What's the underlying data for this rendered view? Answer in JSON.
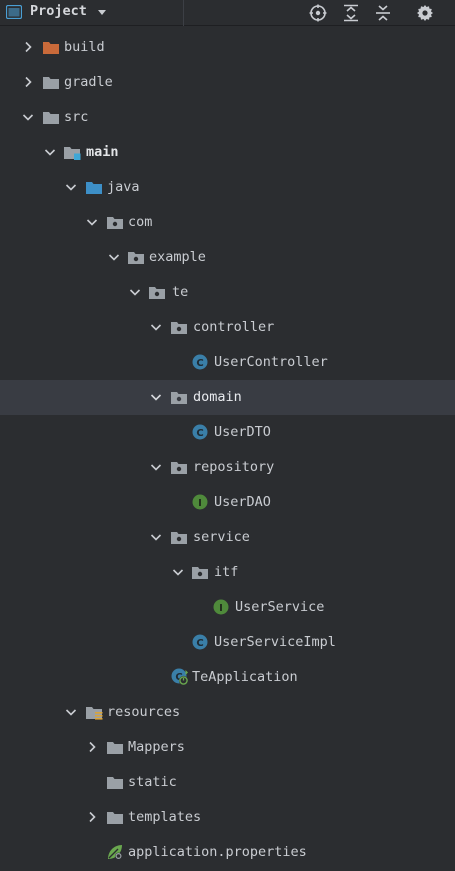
{
  "toolbar": {
    "title": "Project",
    "icons": [
      "panel-icon",
      "chevron-down-icon",
      "locate-icon",
      "expand-all-icon",
      "collapse-all-icon",
      "gear-icon"
    ]
  },
  "colors": {
    "background": "#2b2d30",
    "selection": "#393c43",
    "folder_gray": "#9aa0a6",
    "folder_orange": "#c96a3a",
    "folder_blue": "#3d8fc7",
    "class_blue": "#3a7fa8",
    "interface_green": "#4f8a3b",
    "spring_green": "#6aa84f"
  },
  "tree": {
    "items": [
      {
        "label": "build",
        "icon": "excluded-folder-icon",
        "expanded": false
      },
      {
        "label": "gradle",
        "icon": "folder-icon",
        "expanded": false
      },
      {
        "label": "src",
        "icon": "folder-icon",
        "expanded": true
      },
      {
        "label": "main",
        "icon": "source-root-module-icon",
        "expanded": true
      },
      {
        "label": "java",
        "icon": "sources-folder-icon",
        "expanded": true
      },
      {
        "label": "com",
        "icon": "package-icon",
        "expanded": true
      },
      {
        "label": "example",
        "icon": "package-icon",
        "expanded": true
      },
      {
        "label": "te",
        "icon": "package-icon",
        "expanded": true
      },
      {
        "label": "controller",
        "icon": "package-icon",
        "expanded": true
      },
      {
        "label": "UserController",
        "icon": "class-icon"
      },
      {
        "label": "domain",
        "icon": "package-icon",
        "expanded": true,
        "selected": true
      },
      {
        "label": "UserDTO",
        "icon": "class-icon"
      },
      {
        "label": "repository",
        "icon": "package-icon",
        "expanded": true
      },
      {
        "label": "UserDAO",
        "icon": "interface-icon"
      },
      {
        "label": "service",
        "icon": "package-icon",
        "expanded": true
      },
      {
        "label": "itf",
        "icon": "package-icon",
        "expanded": true
      },
      {
        "label": "UserService",
        "icon": "interface-icon"
      },
      {
        "label": "UserServiceImpl",
        "icon": "class-icon"
      },
      {
        "label": "TeApplication",
        "icon": "spring-boot-class-icon"
      },
      {
        "label": "resources",
        "icon": "resources-folder-icon",
        "expanded": true
      },
      {
        "label": "Mappers",
        "icon": "folder-icon",
        "expanded": false
      },
      {
        "label": "static",
        "icon": "folder-icon"
      },
      {
        "label": "templates",
        "icon": "folder-icon",
        "expanded": false
      },
      {
        "label": "application.properties",
        "icon": "spring-properties-icon"
      }
    ]
  }
}
